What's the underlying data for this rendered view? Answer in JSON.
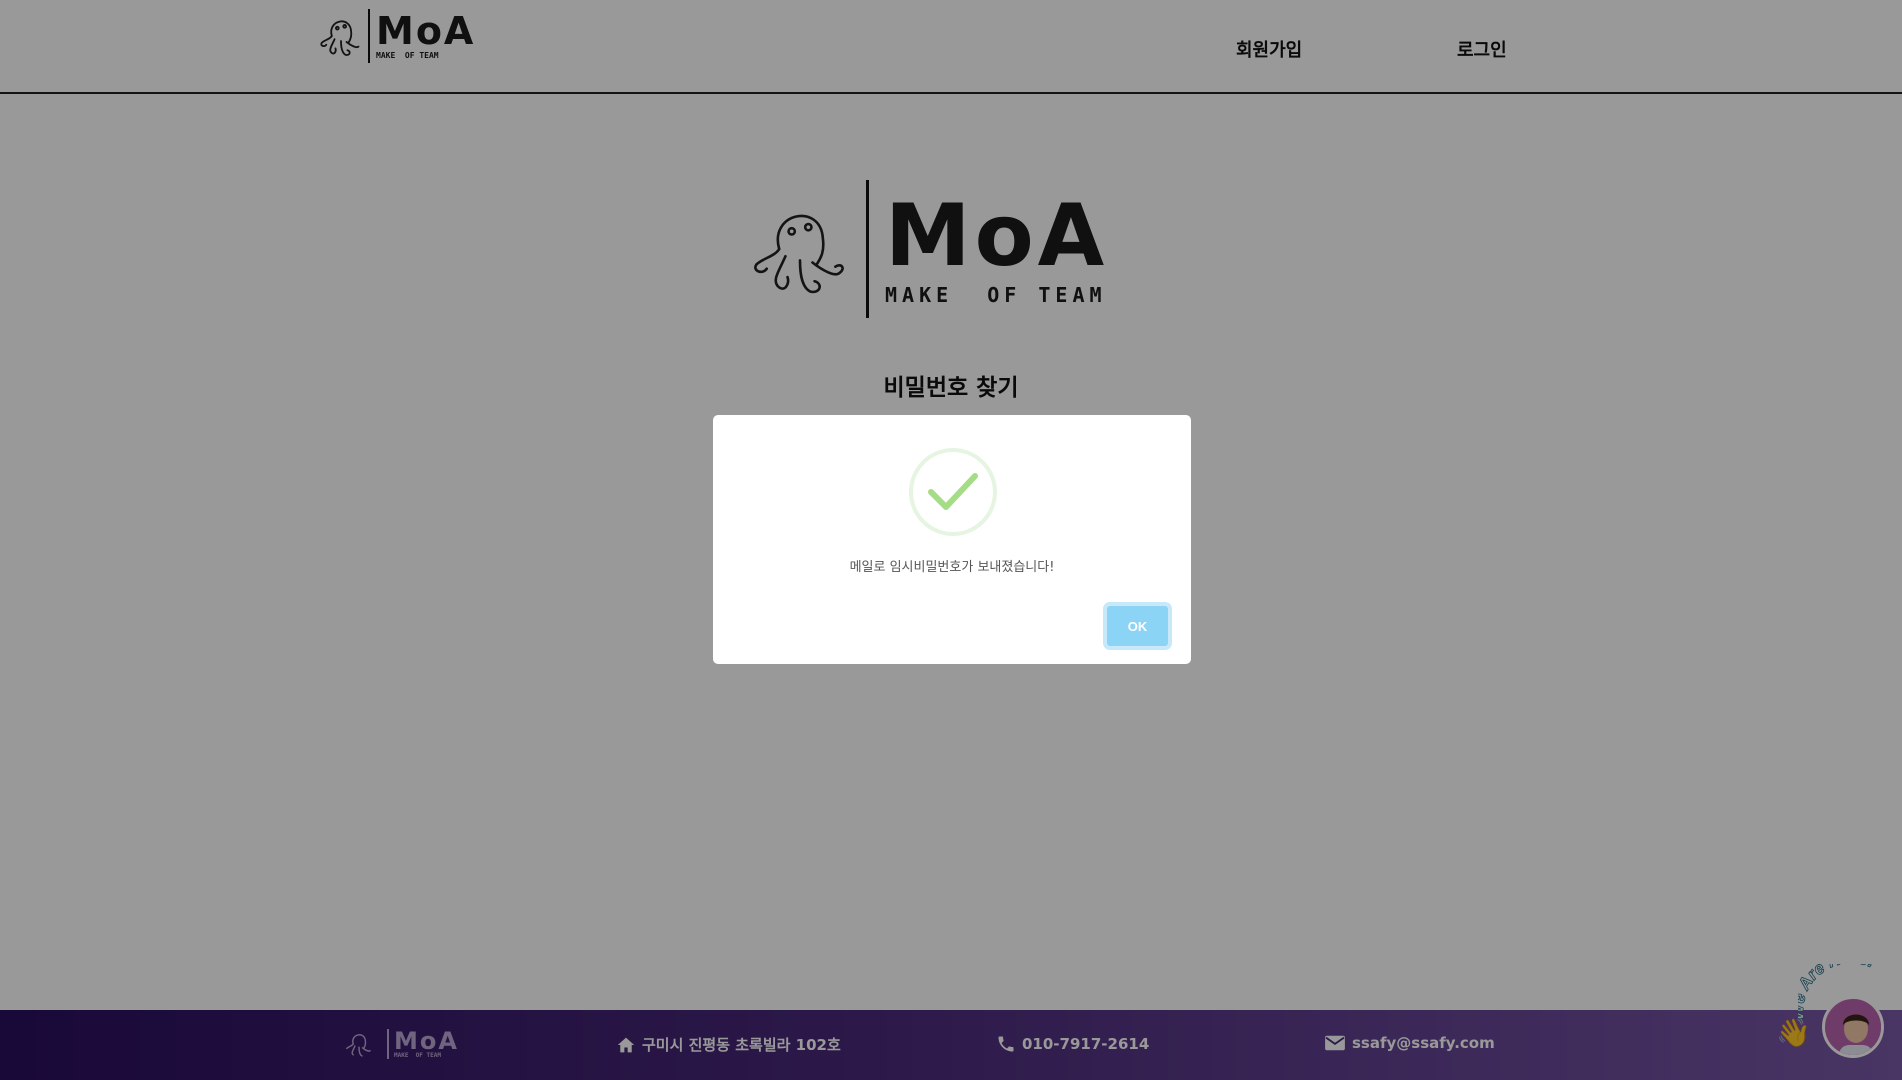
{
  "header": {
    "logo": {
      "word": "MoA",
      "tagline": "MAKE  OF TEAM"
    },
    "nav": [
      {
        "label": "회원가입"
      },
      {
        "label": "로그인"
      }
    ]
  },
  "main": {
    "logo": {
      "word": "MoA",
      "tagline": "MAKE  OF TEAM"
    },
    "title": "비밀번호 찾기"
  },
  "modal": {
    "icon": "success-check-icon",
    "message": "메일로 임시비밀번호가 보내졌습니다!",
    "ok_label": "OK"
  },
  "footer": {
    "logo": {
      "word": "MoA",
      "tagline": "MAKE  OF TEAM"
    },
    "address": "구미시 진평동 초록빌라 102호",
    "phone": "010-7917-2614",
    "email": "ssafy@ssafy.com"
  },
  "chat_widget": {
    "badge": "We Are Here!"
  },
  "colors": {
    "overlay": "rgba(0,0,0,0.4)",
    "ok_button": "#8cd4f5",
    "success_check": "#a5dc86",
    "footer_start": "#2a0f5e",
    "footer_end": "#7a5aa8"
  }
}
